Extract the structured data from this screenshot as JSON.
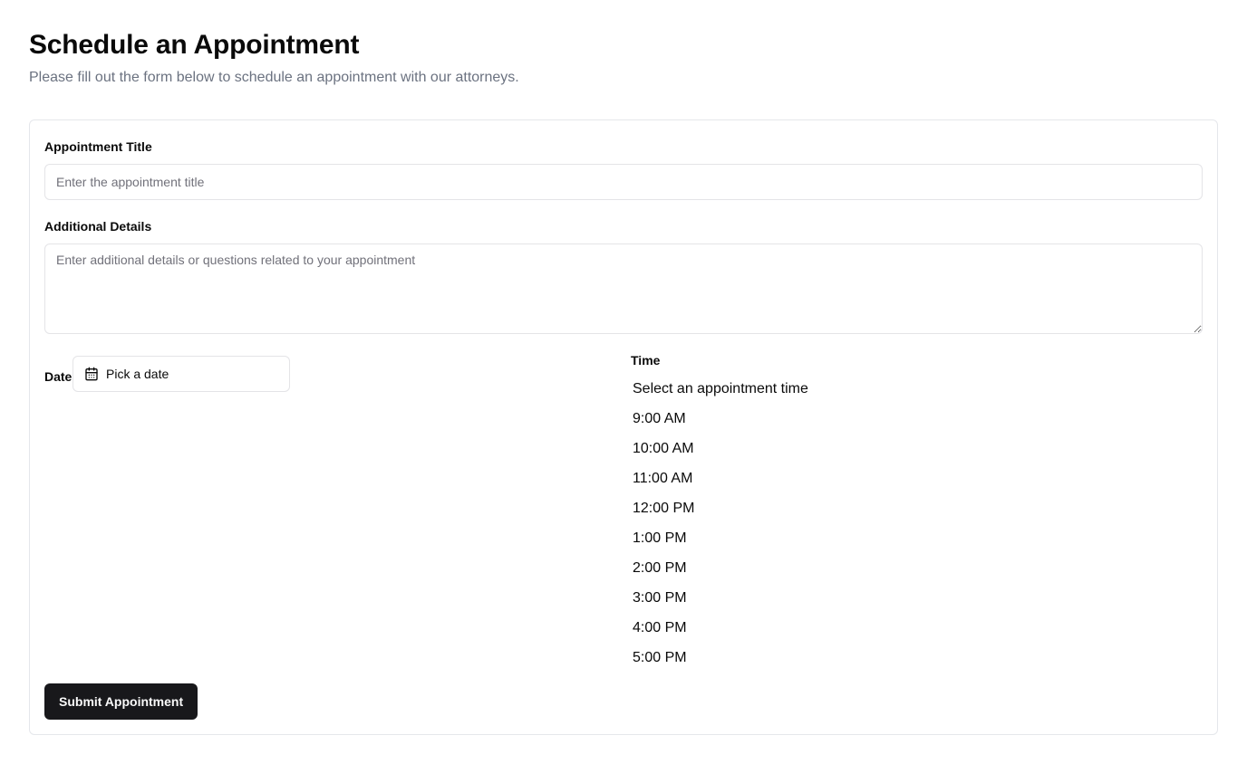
{
  "header": {
    "title": "Schedule an Appointment",
    "subtitle": "Please fill out the form below to schedule an appointment with our attorneys."
  },
  "form": {
    "title_field": {
      "label": "Appointment Title",
      "placeholder": "Enter the appointment title",
      "value": ""
    },
    "details_field": {
      "label": "Additional Details",
      "placeholder": "Enter additional details or questions related to your appointment",
      "value": ""
    },
    "date_field": {
      "label": "Date",
      "button_text": "Pick a date",
      "icon": "calendar-icon"
    },
    "time_field": {
      "label": "Time",
      "options": [
        "Select an appointment time",
        "9:00 AM",
        "10:00 AM",
        "11:00 AM",
        "12:00 PM",
        "1:00 PM",
        "2:00 PM",
        "3:00 PM",
        "4:00 PM",
        "5:00 PM"
      ]
    },
    "submit_label": "Submit Appointment"
  },
  "colors": {
    "primary_button_bg": "#18181b",
    "primary_button_text": "#fafafa",
    "muted_text": "#6b7280",
    "border": "#e4e4e7"
  }
}
